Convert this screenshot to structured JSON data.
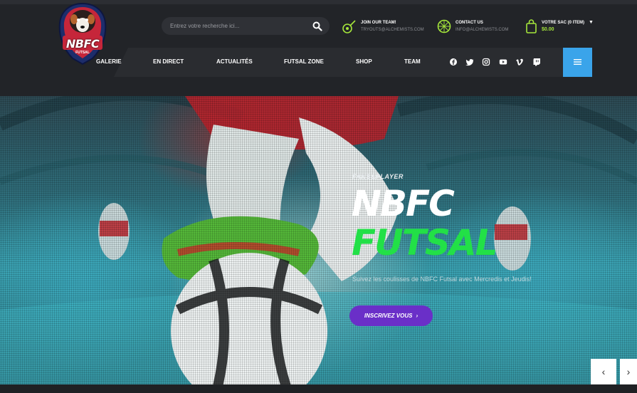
{
  "logo": {
    "text": "NBFC",
    "subtext": "FUTSAL"
  },
  "search": {
    "placeholder": "Entrez votre recherche ici..."
  },
  "header_info": [
    {
      "title": "JOIN OUR TEAM!",
      "subtitle": "TRYOUTS@ALCHEMISTS.COM",
      "icon": "whistle-icon"
    },
    {
      "title": "CONTACT US",
      "subtitle": "INFO@ALCHEMISTS.COM",
      "icon": "ball-icon"
    }
  ],
  "cart": {
    "title": "VOTRE SAC (0 ITEM)",
    "total": "$0.00",
    "icon": "shopping-bag-icon"
  },
  "nav": {
    "items": [
      "GALERIE",
      "EN DIRECT",
      "ACTUALITÉS",
      "FUTSAL ZONE",
      "SHOP",
      "TEAM"
    ],
    "social": [
      "facebook-icon",
      "twitter-icon",
      "instagram-icon",
      "youtube-icon",
      "vimeo-icon",
      "twitch-icon"
    ]
  },
  "hero": {
    "pretitle": "FANS&PLAYER",
    "title_line1": "NBFC",
    "title_line2": "FUTSAL",
    "description": "Suivez les coulisses de NBFC Futsal avec Mercredis et Jeudis!",
    "cta_label": "INSCRIVEZ VOUS",
    "cta_chevron": "›"
  },
  "slider": {
    "prev": "‹",
    "next": "›"
  },
  "colors": {
    "accent_green": "#22e047",
    "accent_purple": "#6a2fc8",
    "accent_blue": "#3aa4ea",
    "lime": "#a5e63b"
  }
}
